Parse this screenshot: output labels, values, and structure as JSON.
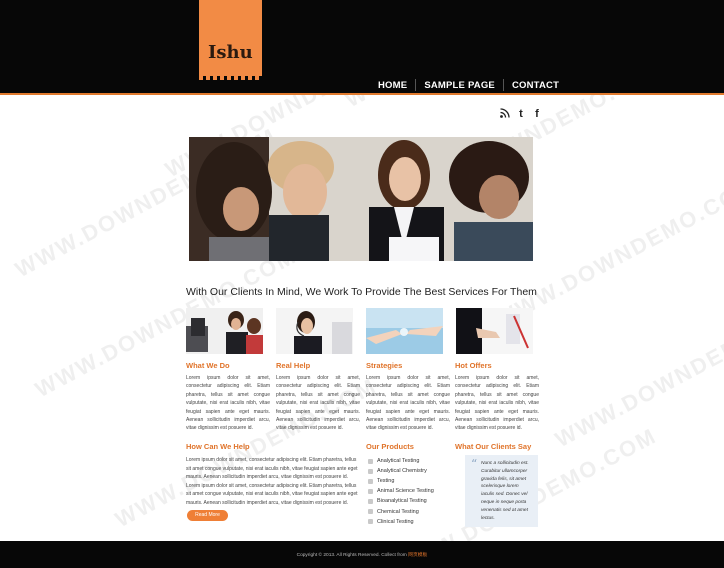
{
  "brand": {
    "logo_text": "Ishu"
  },
  "nav": {
    "items": [
      "HOME",
      "SAMPLE PAGE",
      "CONTACT"
    ]
  },
  "social": {
    "icons": [
      "rss-icon",
      "twitter-icon",
      "facebook-icon"
    ]
  },
  "hero": {
    "alt": "Business team photo"
  },
  "tagline": "With Our Clients In Mind, We Work To Provide The Best Services For Them",
  "features": [
    {
      "title": "What We Do",
      "text": "Lorem ipsum dolor sit amet, consectetur adipiscing elit. Etiam pharetra, tellus sit amet congue vulputate, nisi erat iaculis nibh, vitae feugiat sapien ante eget mauris. Aenean sollicitudin imperdiet arcu, vitae dignissim est posuere id."
    },
    {
      "title": "Real Help",
      "text": "Lorem ipsum dolor sit amet, consectetur adipiscing elit. Etiam pharetra, tellus sit amet congue vulputate, nisi erat iaculis nibh, vitae feugiat sapien ante eget mauris. Aenean sollicitudin imperdiet arcu, vitae dignissim est posuere id."
    },
    {
      "title": "Strategies",
      "text": "Lorem ipsum dolor sit amet, consectetur adipiscing elit. Etiam pharetra, tellus sit amet congue vulputate, nisi erat iaculis nibh, vitae feugiat sapien ante eget mauris. Aenean sollicitudin imperdiet arcu, vitae dignissim est posuere id."
    },
    {
      "title": "Hot Offers",
      "text": "Lorem ipsum dolor sit amet, consectetur adipiscing elit. Etiam pharetra, tellus sit amet congue vulputate, nisi erat iaculis nibh, vitae feugiat sapien ante eget mauris. Aenean sollicitudin imperdiet arcu, vitae dignissim est posuere id."
    }
  ],
  "help": {
    "title": "How Can We Help",
    "text": "Lorem ipsum dolor sit amet, consectetur adipiscing elit. Etiam pharetra, tellus sit amet congue vulputate, nisi erat iaculis nibh, vitae feugiat sapien ante eget mauris. Aenean sollicitudin imperdiet arcu, vitae dignissim est posuere id. Lorem ipsum dolor sit amet, consectetur adipiscing elit. Etiam pharetra, tellus sit amet congue vulputate, nisi erat iaculis nibh, vitae feugiat sapien ante eget mauris. Aenean sollicitudin imperdiet arcu, vitae dignissim est posuere id.",
    "button": "Read More"
  },
  "products": {
    "title": "Our Products",
    "items": [
      "Analytical Testing",
      "Analytical Chemistry",
      "Testing",
      "Animal Science Testing",
      "Bioanalytical Testing",
      "Chemical Testing",
      "Clinical Testing"
    ]
  },
  "testimonial": {
    "title": "What Our Clients Say",
    "quote": "Nunc a sollicitudin est. Curabitur ullamcorper gravida felis, sit amet scelerisque lorem iaculis sed. Donec vel neque in neque porta venenatis sed at amet lectus."
  },
  "footer": {
    "text": "Copyright © 2013. All Rights Reserved. Collect from",
    "link": "网页模板"
  }
}
